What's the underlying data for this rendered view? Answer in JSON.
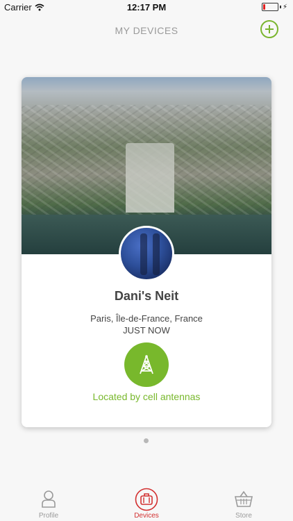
{
  "status_bar": {
    "carrier": "Carrier",
    "time": "12:17 PM",
    "battery_level": 0.15
  },
  "header": {
    "title": "MY DEVICES"
  },
  "device": {
    "name": "Dani's Neit",
    "location": "Paris, Île-de-France, France",
    "time": "JUST NOW",
    "located_by": "Located by cell antennas"
  },
  "tabs": [
    {
      "label": "Profile",
      "icon": "person-icon"
    },
    {
      "label": "Devices",
      "icon": "bag-icon",
      "active": true
    },
    {
      "label": "Store",
      "icon": "basket-icon"
    }
  ],
  "colors": {
    "accent_green": "#78b82c",
    "active_tab_red": "#d23030",
    "inactive_gray": "#9a9a9a"
  }
}
